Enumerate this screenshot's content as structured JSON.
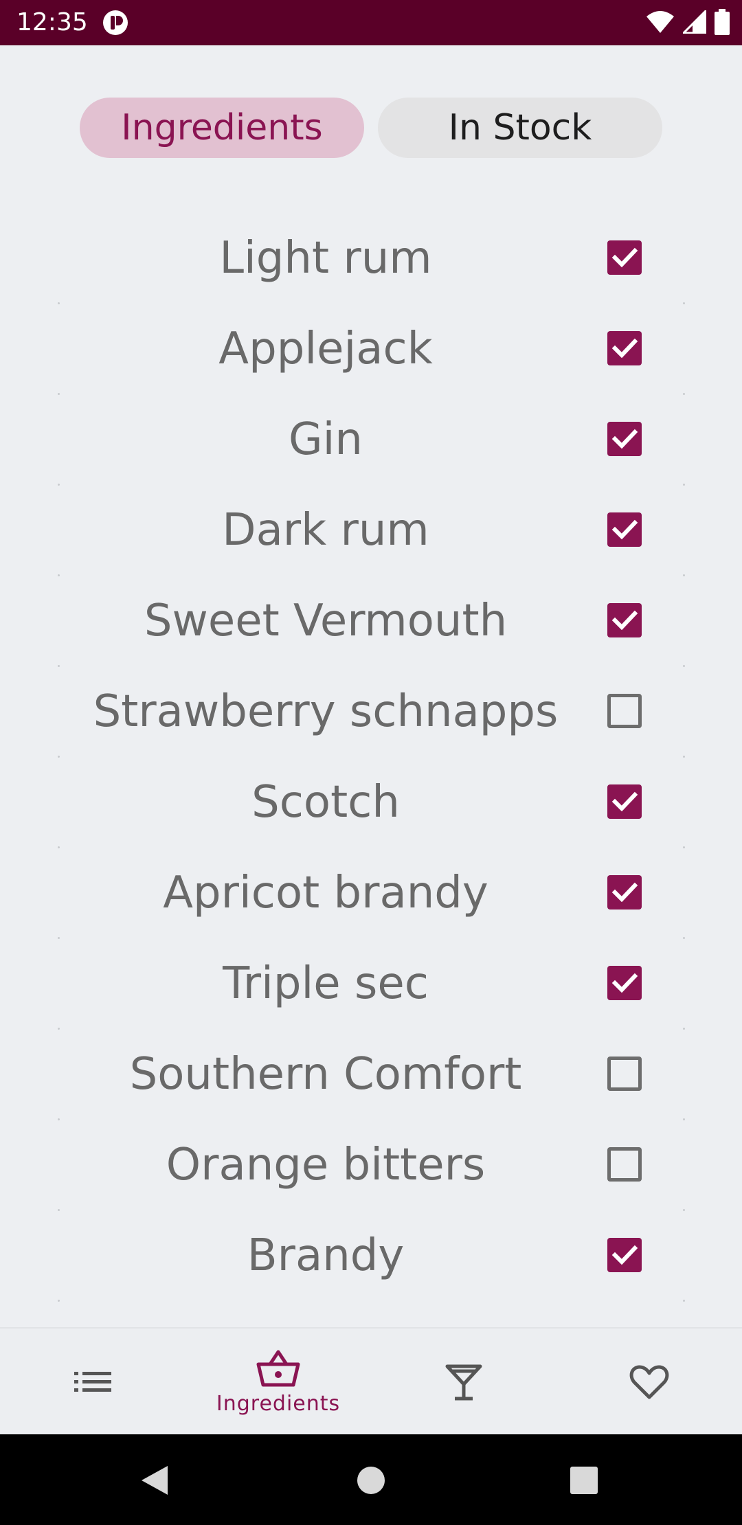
{
  "status_bar": {
    "time": "12:35"
  },
  "tabs": [
    {
      "label": "Ingredients",
      "selected": true
    },
    {
      "label": "In Stock",
      "selected": false
    }
  ],
  "ingredients": [
    {
      "name": "Light rum",
      "checked": true
    },
    {
      "name": "Applejack",
      "checked": true
    },
    {
      "name": "Gin",
      "checked": true
    },
    {
      "name": "Dark rum",
      "checked": true
    },
    {
      "name": "Sweet Vermouth",
      "checked": true
    },
    {
      "name": "Strawberry schnapps",
      "checked": false
    },
    {
      "name": "Scotch",
      "checked": true
    },
    {
      "name": "Apricot brandy",
      "checked": true
    },
    {
      "name": "Triple sec",
      "checked": true
    },
    {
      "name": "Southern Comfort",
      "checked": false
    },
    {
      "name": "Orange bitters",
      "checked": false
    },
    {
      "name": "Brandy",
      "checked": true
    }
  ],
  "bottom_nav": {
    "items": [
      {
        "icon": "list-icon",
        "label": ""
      },
      {
        "icon": "basket-icon",
        "label": "Ingredients",
        "active": true
      },
      {
        "icon": "cocktail-glass-icon",
        "label": ""
      },
      {
        "icon": "heart-icon",
        "label": ""
      }
    ]
  },
  "colors": {
    "accent": "#8a1452",
    "status_bar": "#5a0028",
    "background": "#edeff2"
  }
}
